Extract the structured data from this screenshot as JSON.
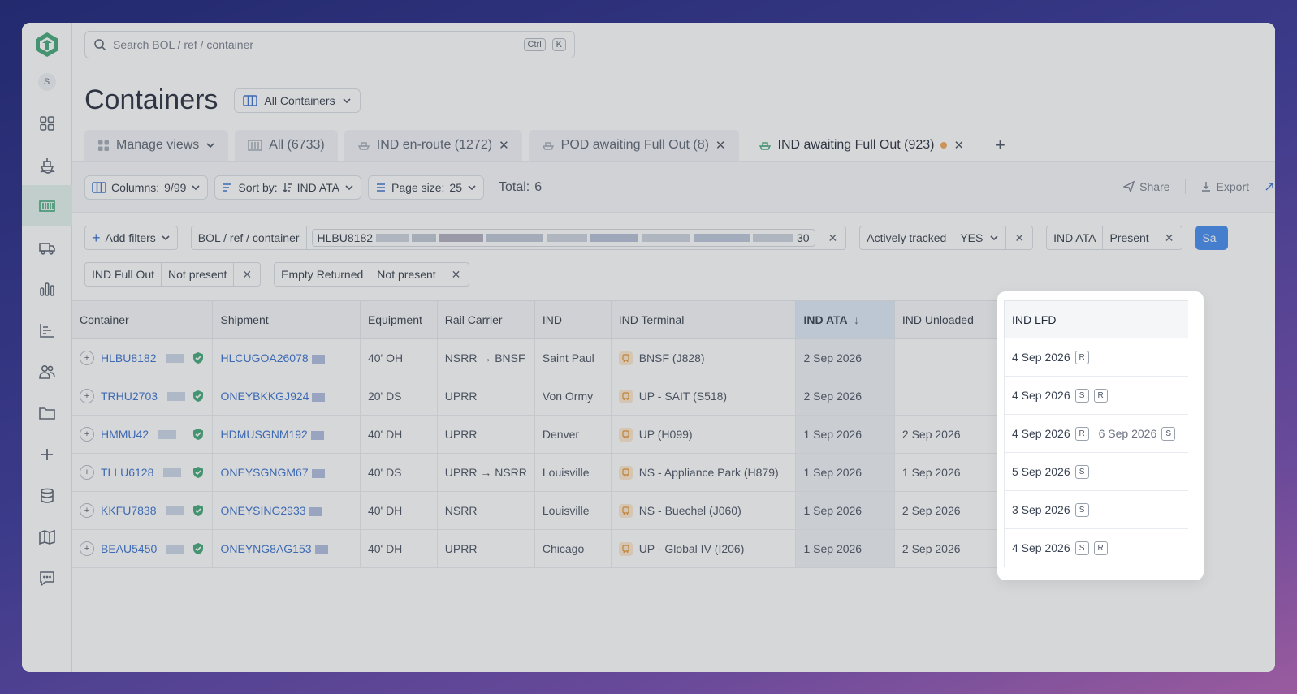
{
  "search": {
    "placeholder": "Search BOL / ref / container",
    "kbd1": "Ctrl",
    "kbd2": "K"
  },
  "sidebar": {
    "avatar": "S"
  },
  "page": {
    "title": "Containers",
    "view_label": "All Containers"
  },
  "tabs": [
    {
      "label": "Manage views"
    },
    {
      "label": "All (6733)"
    },
    {
      "label": "IND en-route (1272)"
    },
    {
      "label": "POD awaiting Full Out (8)"
    },
    {
      "label": "IND awaiting Full Out (923)"
    }
  ],
  "toolbar": {
    "columns_label": "Columns:",
    "columns_value": "9/99",
    "sort_label": "Sort by:",
    "sort_value": "IND ATA",
    "pagesize_label": "Page size:",
    "pagesize_value": "25",
    "total_label": "Total:",
    "total_value": "6",
    "share": "Share",
    "export": "Export"
  },
  "filters": {
    "add": "Add filters",
    "bol_label": "BOL / ref / container",
    "bol_value_start": "HLBU8182",
    "bol_value_end": "30",
    "tracked_label": "Actively tracked",
    "tracked_value": "YES",
    "ata_label": "IND ATA",
    "ata_value": "Present",
    "save": "Sa",
    "fullout_label": "IND Full Out",
    "fullout_value": "Not present",
    "empty_label": "Empty Returned",
    "empty_value": "Not present"
  },
  "table": {
    "headers": [
      "Container",
      "Shipment",
      "Equipment",
      "Rail Carrier",
      "IND",
      "IND Terminal",
      "IND ATA",
      "IND Unloaded",
      "IND LFD"
    ],
    "rows": [
      {
        "container": "HLBU8182",
        "shipment": "HLCUGOA26078",
        "equipment": "40' OH",
        "rail": "NSRR → BNSF",
        "ind": "Saint Paul",
        "terminal": "BNSF (J828)",
        "ata": "2 Sep 2026",
        "unloaded": "",
        "lfd": "4 Sep 2026",
        "tags": [
          "R"
        ],
        "lfd2": "",
        "tags2": []
      },
      {
        "container": "TRHU2703",
        "shipment": "ONEYBKKGJ924",
        "equipment": "20' DS",
        "rail": "UPRR",
        "ind": "Von Ormy",
        "terminal": "UP - SAIT (S518)",
        "ata": "2 Sep 2026",
        "unloaded": "",
        "lfd": "4 Sep 2026",
        "tags": [
          "S",
          "R"
        ],
        "lfd2": "",
        "tags2": []
      },
      {
        "container": "HMMU42",
        "shipment": "HDMUSGNM192",
        "equipment": "40' DH",
        "rail": "UPRR",
        "ind": "Denver",
        "terminal": "UP (H099)",
        "ata": "1 Sep 2026",
        "unloaded": "2 Sep 2026",
        "lfd": "4 Sep 2026",
        "tags": [
          "R"
        ],
        "lfd2": "6 Sep 2026",
        "tags2": [
          "S"
        ]
      },
      {
        "container": "TLLU6128",
        "shipment": "ONEYSGNGM67",
        "equipment": "40' DS",
        "rail": "UPRR → NSRR",
        "ind": "Louisville",
        "terminal": "NS - Appliance Park (H879)",
        "ata": "1 Sep 2026",
        "unloaded": "1 Sep 2026",
        "lfd": "5 Sep 2026",
        "tags": [
          "S"
        ],
        "lfd2": "",
        "tags2": []
      },
      {
        "container": "KKFU7838",
        "shipment": "ONEYSING2933",
        "equipment": "40' DH",
        "rail": "NSRR",
        "ind": "Louisville",
        "terminal": "NS - Buechel (J060)",
        "ata": "1 Sep 2026",
        "unloaded": "2 Sep 2026",
        "lfd": "3 Sep 2026",
        "tags": [
          "S"
        ],
        "lfd2": "",
        "tags2": []
      },
      {
        "container": "BEAU5450",
        "shipment": "ONEYNG8AG153",
        "equipment": "40' DH",
        "rail": "UPRR",
        "ind": "Chicago",
        "terminal": "UP - Global IV (I206)",
        "ata": "1 Sep 2026",
        "unloaded": "2 Sep 2026",
        "lfd": "4 Sep 2026",
        "tags": [
          "S",
          "R"
        ],
        "lfd2": "",
        "tags2": []
      }
    ]
  },
  "colors": {
    "accent": "#2f80ed",
    "brand": "#2e9e6b",
    "link": "#2563c9"
  }
}
